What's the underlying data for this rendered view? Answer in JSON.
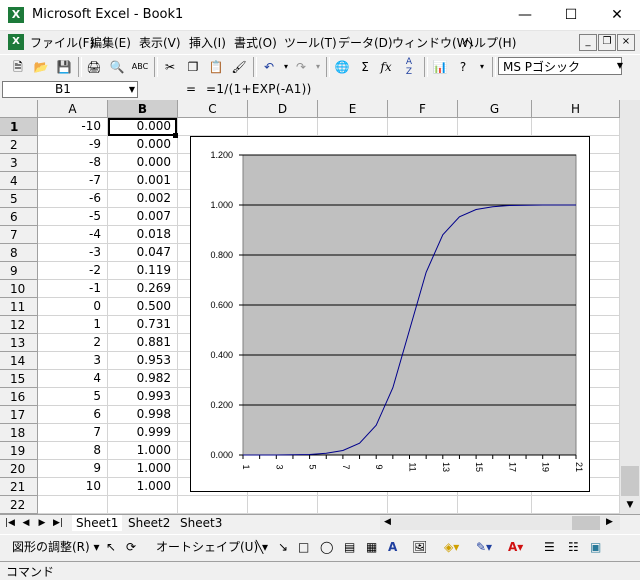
{
  "window": {
    "title": "Microsoft Excel - Book1",
    "app_icon": "X",
    "minimize": "—",
    "maximize": "☐",
    "close": "✕"
  },
  "menu": [
    "ファイル(F)",
    "編集(E)",
    "表示(V)",
    "挿入(I)",
    "書式(O)",
    "ツール(T)",
    "データ(D)",
    "ウィンドウ(W)",
    "ヘルプ(H)"
  ],
  "doc_controls": {
    "minimize": "_",
    "restore": "❐",
    "close": "×"
  },
  "toolbar": {
    "font_name": "MS Pゴシック"
  },
  "formula_bar": {
    "name_box": "B1",
    "equals": "=",
    "formula": "=1/(1+EXP(-A1))"
  },
  "columns": [
    "A",
    "B",
    "C",
    "D",
    "E",
    "F",
    "G",
    "H"
  ],
  "rows": [
    {
      "n": "1",
      "a": "-10",
      "b": "0.000"
    },
    {
      "n": "2",
      "a": "-9",
      "b": "0.000"
    },
    {
      "n": "3",
      "a": "-8",
      "b": "0.000"
    },
    {
      "n": "4",
      "a": "-7",
      "b": "0.001"
    },
    {
      "n": "5",
      "a": "-6",
      "b": "0.002"
    },
    {
      "n": "6",
      "a": "-5",
      "b": "0.007"
    },
    {
      "n": "7",
      "a": "-4",
      "b": "0.018"
    },
    {
      "n": "8",
      "a": "-3",
      "b": "0.047"
    },
    {
      "n": "9",
      "a": "-2",
      "b": "0.119"
    },
    {
      "n": "10",
      "a": "-1",
      "b": "0.269"
    },
    {
      "n": "11",
      "a": "0",
      "b": "0.500"
    },
    {
      "n": "12",
      "a": "1",
      "b": "0.731"
    },
    {
      "n": "13",
      "a": "2",
      "b": "0.881"
    },
    {
      "n": "14",
      "a": "3",
      "b": "0.953"
    },
    {
      "n": "15",
      "a": "4",
      "b": "0.982"
    },
    {
      "n": "16",
      "a": "5",
      "b": "0.993"
    },
    {
      "n": "17",
      "a": "6",
      "b": "0.998"
    },
    {
      "n": "18",
      "a": "7",
      "b": "0.999"
    },
    {
      "n": "19",
      "a": "8",
      "b": "1.000"
    },
    {
      "n": "20",
      "a": "9",
      "b": "1.000"
    },
    {
      "n": "21",
      "a": "10",
      "b": "1.000"
    },
    {
      "n": "22",
      "a": "",
      "b": ""
    }
  ],
  "chart_data": {
    "type": "line",
    "x": [
      1,
      2,
      3,
      4,
      5,
      6,
      7,
      8,
      9,
      10,
      11,
      12,
      13,
      14,
      15,
      16,
      17,
      18,
      19,
      20,
      21
    ],
    "series": [
      {
        "values": [
          0.0,
          0.0,
          0.0,
          0.001,
          0.002,
          0.007,
          0.018,
          0.047,
          0.119,
          0.269,
          0.5,
          0.731,
          0.881,
          0.953,
          0.982,
          0.993,
          0.998,
          0.999,
          1.0,
          1.0,
          1.0
        ]
      }
    ],
    "x_tick_labels": [
      "1",
      "3",
      "5",
      "7",
      "9",
      "11",
      "13",
      "15",
      "17",
      "19",
      "21"
    ],
    "y_tick_labels": [
      "0.000",
      "0.200",
      "0.400",
      "0.600",
      "0.800",
      "1.000",
      "1.200"
    ],
    "ylim": [
      0,
      1.2
    ],
    "plot_bg": "#c0c0c0",
    "line_color": "#00008b",
    "grid": true
  },
  "sheets": [
    "Sheet1",
    "Sheet2",
    "Sheet3"
  ],
  "draw_toolbar": {
    "adjust": "図形の調整(R) ▾",
    "autoshape": "オートシェイプ(U) ▾"
  },
  "status": "コマンド"
}
